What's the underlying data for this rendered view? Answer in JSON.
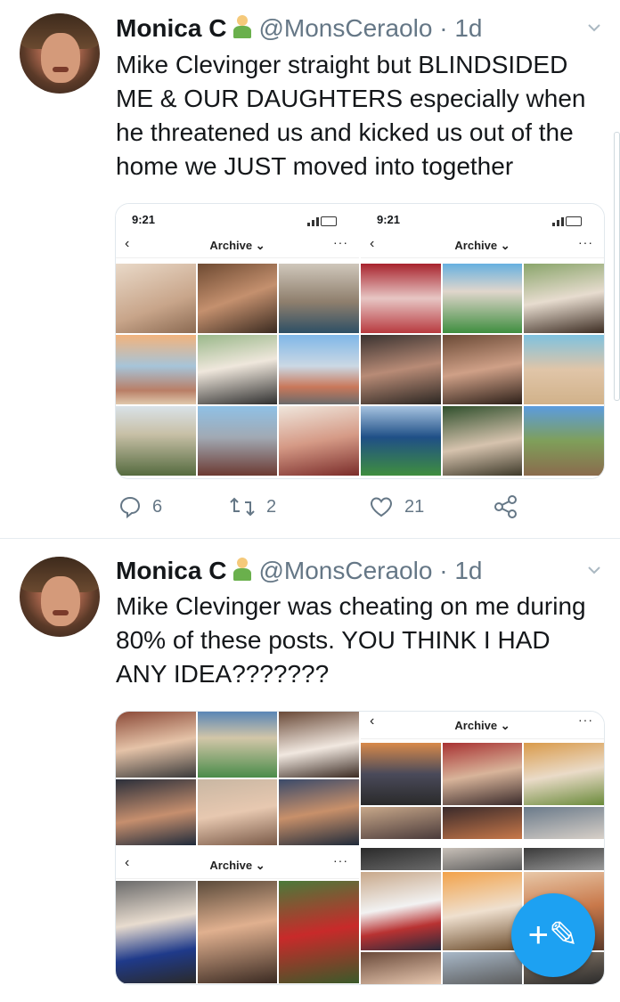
{
  "tweets": [
    {
      "author_name": "Monica C",
      "author_handle": "@MonsCeraolo",
      "separator": "·",
      "timestamp": "1d",
      "emoji_icon": "mermaid-emoji-icon",
      "text": "Mike Clevinger straight but BLINDSIDED ME & OUR DAUGHTERS especially when he threatened us and kicked us out of the home we JUST moved into together",
      "media": [
        {
          "status_time": "9:21",
          "nav_title": "Archive ⌄",
          "nav_back": "‹",
          "nav_more": "···"
        },
        {
          "status_time": "9:21",
          "nav_title": "Archive ⌄",
          "nav_back": "‹",
          "nav_more": "···"
        }
      ],
      "replies": "6",
      "retweets": "2",
      "likes": "21"
    },
    {
      "author_name": "Monica C",
      "author_handle": "@MonsCeraolo",
      "separator": "·",
      "timestamp": "1d",
      "emoji_icon": "mermaid-emoji-icon",
      "text": "Mike Clevinger was cheating on me during 80% of these posts. YOU THINK I HAD ANY IDEA???????",
      "media": [
        {
          "nav_title": "Archive ⌄",
          "nav_back": "‹",
          "nav_more": "···"
        },
        {
          "nav_title": "Archive ⌄",
          "nav_back": "‹",
          "nav_more": "···"
        }
      ]
    }
  ],
  "fab": {
    "label": "+✎",
    "icon": "compose-tweet-icon"
  },
  "colors": {
    "accent": "#1da1f2",
    "secondary_text": "#657786",
    "primary_text": "#14171a"
  }
}
